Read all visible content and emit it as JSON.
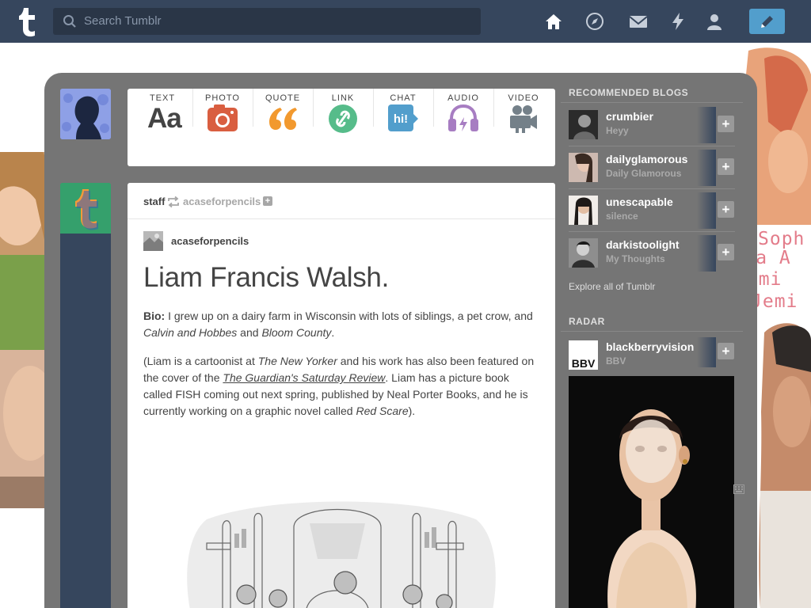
{
  "topbar": {
    "search_placeholder": "Search Tumblr",
    "nav_icons": [
      "home-icon",
      "explore-icon",
      "messages-icon",
      "activity-icon",
      "account-icon"
    ],
    "compose_icon": "pencil-icon",
    "color": "#36465d"
  },
  "post_types": [
    {
      "label": "TEXT",
      "icon": "text-icon",
      "color": "#444444"
    },
    {
      "label": "PHOTO",
      "icon": "photo-icon",
      "color": "#d95e40"
    },
    {
      "label": "QUOTE",
      "icon": "quote-icon",
      "color": "#f2992e"
    },
    {
      "label": "LINK",
      "icon": "link-icon",
      "color": "#56bc8a"
    },
    {
      "label": "CHAT",
      "icon": "chat-icon",
      "color": "#529ecc"
    },
    {
      "label": "AUDIO",
      "icon": "audio-icon",
      "color": "#a77dc2"
    },
    {
      "label": "VIDEO",
      "icon": "video-icon",
      "color": "#748089"
    }
  ],
  "text_glyph": "Aa",
  "chat_glyph": "hi!",
  "post": {
    "reblogger": "staff",
    "reblogged_from": "acaseforpencils",
    "follow_glyph": "+",
    "source": "acaseforpencils",
    "title": "Liam Francis Walsh.",
    "bio_label": "Bio:",
    "bio_text_1": " I grew up on a dairy farm in Wisconsin with lots of siblings, a pet crow, and ",
    "bio_italic_1": "Calvin and Hobbes",
    "bio_and": " and ",
    "bio_italic_2": "Bloom County",
    "bio_end": ".",
    "p2_a": "(Liam is a cartoonist at ",
    "p2_italic_1": "The New Yorker",
    "p2_b": " and his work has also been featured on the cover of the ",
    "p2_link": "The Guardian's Saturday Review",
    "p2_c": ". Liam has a picture book called FISH coming out next spring, published by Neal Porter Books, and he is currently working on a graphic novel called ",
    "p2_italic_2": "Red Scare",
    "p2_d": ")."
  },
  "sidebar": {
    "recommended_heading": "RECOMMENDED BLOGS",
    "blogs": [
      {
        "name": "crumbier",
        "subtitle": "Heyy"
      },
      {
        "name": "dailyglamorous",
        "subtitle": "Daily Glamorous"
      },
      {
        "name": "unescapable",
        "subtitle": "silence"
      },
      {
        "name": "darkistoolight",
        "subtitle": "My Thoughts"
      }
    ],
    "explore_link": "Explore all of Tumblr",
    "radar_heading": "RADAR",
    "radar_blog": {
      "name": "blackberryvision",
      "subtitle": "BBV",
      "avatar_text": "BBV"
    },
    "follow_glyph": "+"
  },
  "background_text": [
    "Soph",
    "Sophia A",
    "Demi",
    "Jemi"
  ]
}
